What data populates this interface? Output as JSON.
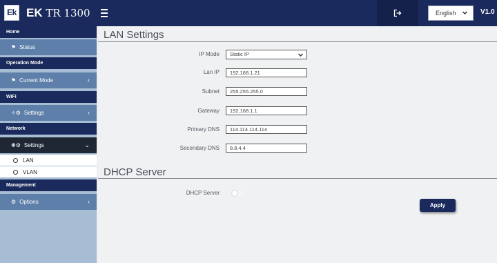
{
  "header": {
    "logo_text": "Ek",
    "brand_bold": "EK",
    "brand_model": "TR 1300",
    "language": "English",
    "version": "V1.0"
  },
  "sidebar": {
    "home_label": "Home",
    "status_label": "Status",
    "operation_mode_label": "Operation Mode",
    "current_mode_label": "Current Mode",
    "wifi_label": "WiFi",
    "wifi_settings_label": "Settings",
    "network_label": "Network",
    "network_settings_label": "Settings",
    "lan_label": "LAN",
    "vlan_label": "VLAN",
    "management_label": "Management",
    "options_label": "Options"
  },
  "lan_settings": {
    "title": "LAN Settings",
    "ip_mode_label": "IP Mode",
    "ip_mode_value": "Static IP",
    "lan_ip_label": "Lan IP",
    "lan_ip_value": "192.168.1.21",
    "subnet_label": "Subnet",
    "subnet_value": "255.255.255.0",
    "gateway_label": "Gateway",
    "gateway_value": "192.168.1.1",
    "primary_dns_label": "Primary DNS",
    "primary_dns_value": "114.114.114.114",
    "secondary_dns_label": "Secondary DNS",
    "secondary_dns_value": "8.8.4.4"
  },
  "dhcp": {
    "title": "DHCP Server",
    "server_label": "DHCP Server",
    "enabled": false
  },
  "apply_label": "Apply",
  "colors": {
    "navy": "#1b2a5c",
    "sidebar_bg": "#a7bdd3",
    "sidebar_item": "#5e7fa9",
    "sidebar_active": "#1e2733"
  }
}
